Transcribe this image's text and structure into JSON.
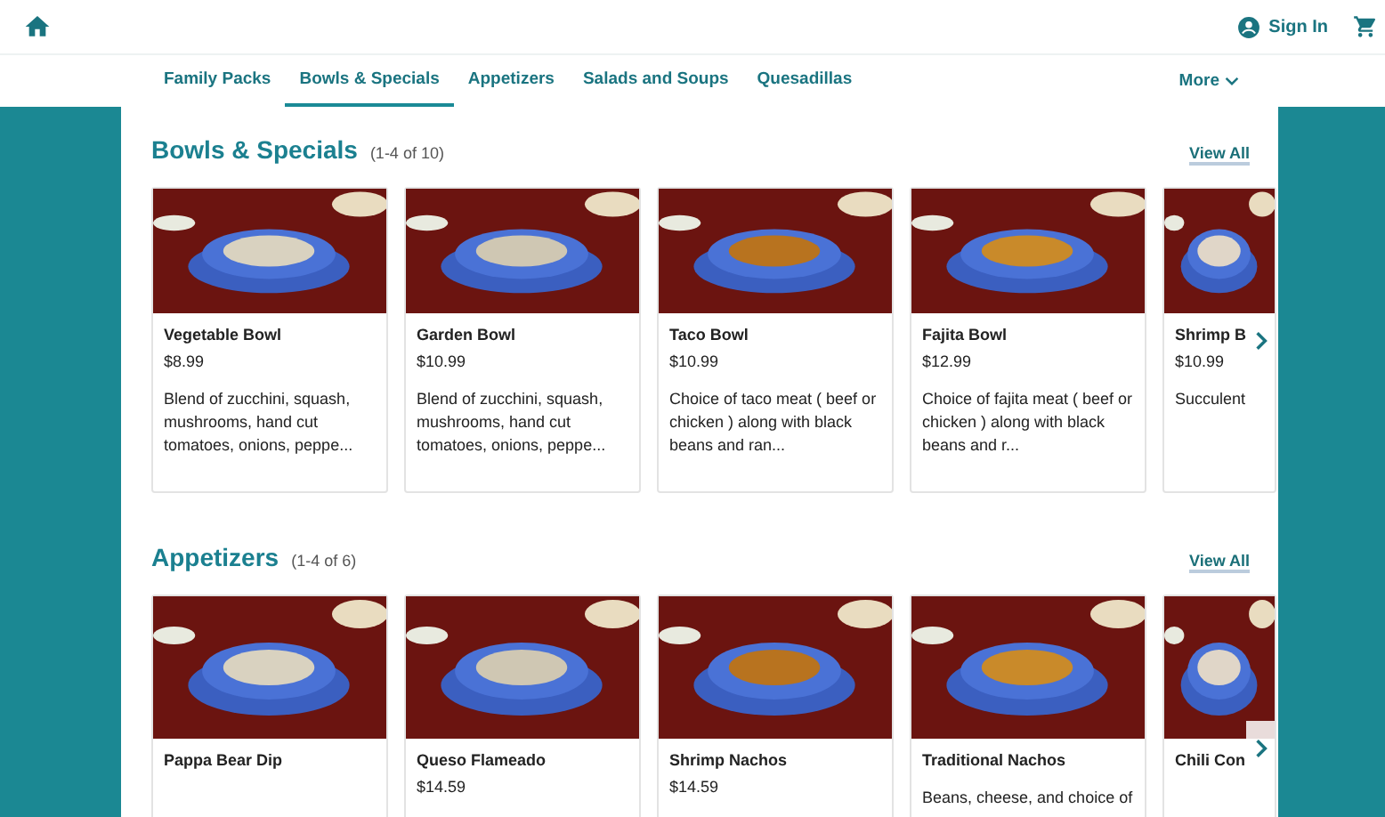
{
  "header": {
    "sign_in": "Sign In"
  },
  "nav": {
    "items": [
      {
        "label": "Family Packs",
        "selected": false
      },
      {
        "label": "Bowls & Specials",
        "selected": true
      },
      {
        "label": "Appetizers",
        "selected": false
      },
      {
        "label": "Salads and Soups",
        "selected": false
      },
      {
        "label": "Quesadillas",
        "selected": false
      }
    ],
    "more": "More"
  },
  "sections": [
    {
      "title": "Bowls & Specials",
      "count": "(1-4 of 10)",
      "view_all": "View All",
      "items": [
        {
          "name": "Vegetable Bowl",
          "price": "$8.99",
          "description": "Blend of zucchini, squash, mushrooms, hand cut tomatoes, onions, peppe..."
        },
        {
          "name": "Garden Bowl",
          "price": "$10.99",
          "description": "Blend of zucchini, squash, mushrooms, hand cut tomatoes, onions, peppe..."
        },
        {
          "name": "Taco Bowl",
          "price": "$10.99",
          "description": "Choice of taco meat ( beef or chicken ) along with black beans and ran..."
        },
        {
          "name": "Fajita Bowl",
          "price": "$12.99",
          "description": "Choice of fajita meat ( beef or chicken ) along with black beans and r..."
        },
        {
          "name": "Shrimp B",
          "price": "$10.99",
          "description": "Succulent"
        }
      ]
    },
    {
      "title": "Appetizers",
      "count": "(1-4 of 6)",
      "view_all": "View All",
      "items": [
        {
          "name": "Pappa Bear Dip"
        },
        {
          "name": "Queso Flameado",
          "price": "$14.59"
        },
        {
          "name": "Shrimp Nachos",
          "price": "$14.59"
        },
        {
          "name": "Traditional Nachos",
          "description": "Beans, cheese, and choice of"
        },
        {
          "name": "Chili Con"
        }
      ]
    }
  ]
}
